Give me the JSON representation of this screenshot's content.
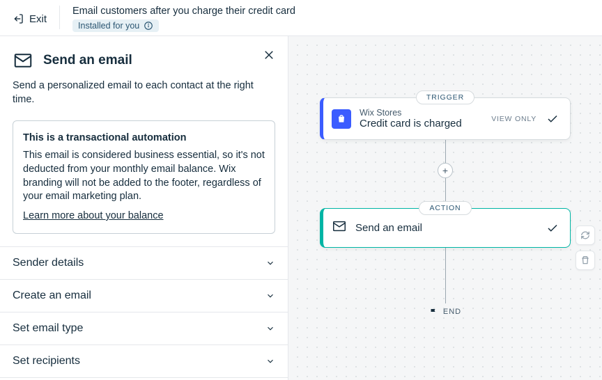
{
  "topbar": {
    "exit": "Exit",
    "title": "Email customers after you charge their credit card",
    "badge": "Installed for you"
  },
  "sidebar": {
    "heading": "Send an email",
    "description": "Send a personalized email to each contact at the right time.",
    "info": {
      "title": "This is a transactional automation",
      "body": "This email is considered business essential, so it's not deducted from your monthly email balance. Wix branding will not be added to the footer, regardless of your email marketing plan.",
      "link": "Learn more about your balance"
    },
    "accordion": [
      {
        "label": "Sender details"
      },
      {
        "label": "Create an email"
      },
      {
        "label": "Set email type"
      },
      {
        "label": "Set recipients"
      }
    ]
  },
  "flow": {
    "trigger_label": "TRIGGER",
    "trigger": {
      "overline": "Wix Stores",
      "title": "Credit card is charged",
      "view_only": "VIEW ONLY"
    },
    "action_label": "ACTION",
    "action": {
      "title": "Send an email"
    },
    "end": "END"
  }
}
